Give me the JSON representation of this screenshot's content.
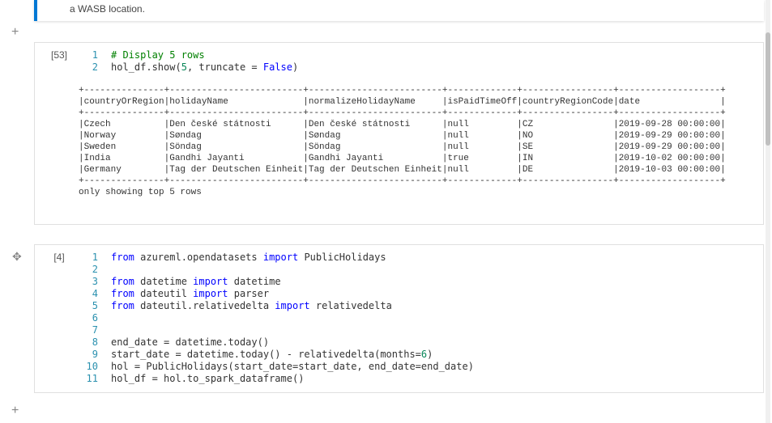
{
  "banner": {
    "text": "a WASB location."
  },
  "add_cell_glyph": "+",
  "cell1": {
    "exec_count": "[53]",
    "line_numbers": [
      "1",
      "2"
    ],
    "code": {
      "l1_comment": "# Display 5 rows",
      "l2_a": "hol_df.show(",
      "l2_n1": "5",
      "l2_b": ", truncate = ",
      "l2_kw": "False",
      "l2_c": ")"
    },
    "output_text": "+---------------+-------------------------+-------------------------+-------------+-----------------+-------------------+\n|countryOrRegion|holidayName              |normalizeHolidayName     |isPaidTimeOff|countryRegionCode|date               |\n+---------------+-------------------------+-------------------------+-------------+-----------------+-------------------+\n|Czech          |Den české státnosti      |Den české státnosti      |null         |CZ               |2019-09-28 00:00:00|\n|Norway         |Søndag                   |Søndag                   |null         |NO               |2019-09-29 00:00:00|\n|Sweden         |Söndag                   |Söndag                   |null         |SE               |2019-09-29 00:00:00|\n|India          |Gandhi Jayanti           |Gandhi Jayanti           |true         |IN               |2019-10-02 00:00:00|\n|Germany        |Tag der Deutschen Einheit|Tag der Deutschen Einheit|null         |DE               |2019-10-03 00:00:00|\n+---------------+-------------------------+-------------------------+-------------+-----------------+-------------------+\nonly showing top 5 rows"
  },
  "cell2": {
    "exec_count": "[4]",
    "move_glyph": "✥",
    "line_numbers": [
      "1",
      "2",
      "3",
      "4",
      "5",
      "6",
      "7",
      "8",
      "9",
      "10",
      "11"
    ],
    "code": {
      "l1_a": "from",
      "l1_b": " azureml.opendatasets ",
      "l1_c": "import",
      "l1_d": " PublicHolidays",
      "l3_a": "from",
      "l3_b": " datetime ",
      "l3_c": "import",
      "l3_d": " datetime",
      "l4_a": "from",
      "l4_b": " dateutil ",
      "l4_c": "import",
      "l4_d": " parser",
      "l5_a": "from",
      "l5_b": " dateutil.relativedelta ",
      "l5_c": "import",
      "l5_d": " relativedelta",
      "l8": "end_date = datetime.today()",
      "l9_a": "start_date = datetime.today() - relativedelta(months=",
      "l9_n": "6",
      "l9_b": ")",
      "l10": "hol = PublicHolidays(start_date=start_date, end_date=end_date)",
      "l11": "hol_df = hol.to_spark_dataframe()"
    }
  },
  "chart_data": {
    "type": "table",
    "title": "only showing top 5 rows",
    "columns": [
      "countryOrRegion",
      "holidayName",
      "normalizeHolidayName",
      "isPaidTimeOff",
      "countryRegionCode",
      "date"
    ],
    "rows": [
      [
        "Czech",
        "Den české státnosti",
        "Den české státnosti",
        "null",
        "CZ",
        "2019-09-28 00:00:00"
      ],
      [
        "Norway",
        "Søndag",
        "Søndag",
        "null",
        "NO",
        "2019-09-29 00:00:00"
      ],
      [
        "Sweden",
        "Söndag",
        "Söndag",
        "null",
        "SE",
        "2019-09-29 00:00:00"
      ],
      [
        "India",
        "Gandhi Jayanti",
        "Gandhi Jayanti",
        "true",
        "IN",
        "2019-10-02 00:00:00"
      ],
      [
        "Germany",
        "Tag der Deutschen Einheit",
        "Tag der Deutschen Einheit",
        "null",
        "DE",
        "2019-10-03 00:00:00"
      ]
    ]
  }
}
